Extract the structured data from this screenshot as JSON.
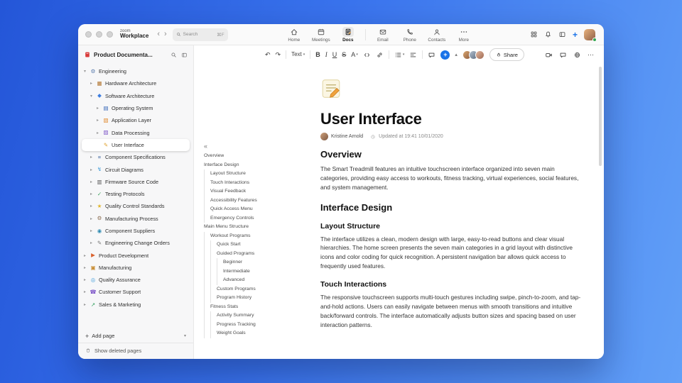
{
  "colors": {
    "accent": "#1a73e8"
  },
  "icons": {
    "undo": "↶",
    "redo": "↷",
    "caret_down": "▾",
    "caret_up": "▴",
    "outline_collapse": "«",
    "plus": "+",
    "more_h": "⋯",
    "tree_expanded": "▾",
    "tree_collapsed": "▸",
    "nav_back": "‹",
    "nav_forward": "›"
  },
  "titlebar": {
    "brand_top": "zoom",
    "brand_bottom": "Workplace",
    "search": {
      "placeholder": "Search",
      "shortcut": "⌘F"
    }
  },
  "topnav": {
    "tabs": [
      {
        "label": "Home"
      },
      {
        "label": "Meetings"
      },
      {
        "label": "Docs",
        "active": true
      },
      {
        "label": "Email"
      },
      {
        "label": "Phone"
      },
      {
        "label": "Contacts"
      },
      {
        "label": "More"
      }
    ]
  },
  "sidebar": {
    "title": "Product Documenta...",
    "items": [
      {
        "label": "Engineering",
        "level": 0,
        "icon": "gear",
        "glyph": "⚙",
        "color": "#5577aa",
        "expanded": true
      },
      {
        "label": "Hardware Architecture",
        "level": 1,
        "icon": "hardware",
        "glyph": "▦",
        "color": "#b0722a"
      },
      {
        "label": "Software Architecture",
        "level": 1,
        "icon": "software",
        "glyph": "◆",
        "color": "#3d7de0",
        "expanded": true
      },
      {
        "label": "Operating System",
        "level": 2,
        "icon": "book",
        "glyph": "▤",
        "color": "#2c5fb3"
      },
      {
        "label": "Application Layer",
        "level": 2,
        "icon": "layers",
        "glyph": "▧",
        "color": "#e08a2e"
      },
      {
        "label": "Data Processing",
        "level": 2,
        "icon": "chart",
        "glyph": "▨",
        "color": "#7a52c7"
      },
      {
        "label": "User Interface",
        "level": 2,
        "icon": "pencil",
        "glyph": "✎",
        "color": "#e0a22e",
        "selected": true
      },
      {
        "label": "Component Specifications",
        "level": 1,
        "icon": "clipboard",
        "glyph": "≡",
        "color": "#4a6fa5"
      },
      {
        "label": "Circuit Diagrams",
        "level": 1,
        "icon": "bolt",
        "glyph": "↯",
        "color": "#3a9ad9"
      },
      {
        "label": "Firmware Source Code",
        "level": 1,
        "icon": "code",
        "glyph": "▥",
        "color": "#5a5a5a"
      },
      {
        "label": "Testing Protocols",
        "level": 1,
        "icon": "check",
        "glyph": "✓",
        "color": "#3aa05a"
      },
      {
        "label": "Quality Control Standards",
        "level": 1,
        "icon": "star",
        "glyph": "★",
        "color": "#e0b52e"
      },
      {
        "label": "Manufacturing Process",
        "level": 1,
        "icon": "factory",
        "glyph": "⚙",
        "color": "#8a6b4f"
      },
      {
        "label": "Component Suppliers",
        "level": 1,
        "icon": "supplier",
        "glyph": "◉",
        "color": "#2e8ab0"
      },
      {
        "label": "Engineering Change Orders",
        "level": 1,
        "icon": "memo",
        "glyph": "✎",
        "color": "#777777"
      },
      {
        "label": "Product Development",
        "level": 0,
        "icon": "rocket",
        "glyph": "▶",
        "color": "#d9622e"
      },
      {
        "label": "Manufacturing",
        "level": 0,
        "icon": "plant",
        "glyph": "▣",
        "color": "#c78a2e"
      },
      {
        "label": "Quality Assurance",
        "level": 0,
        "icon": "target",
        "glyph": "◎",
        "color": "#3a9ad9"
      },
      {
        "label": "Customer Support",
        "level": 0,
        "icon": "phone",
        "glyph": "☎",
        "color": "#7a52c7"
      },
      {
        "label": "Sales & Marketing",
        "level": 0,
        "icon": "trend",
        "glyph": "↗",
        "color": "#2e9e5b"
      }
    ],
    "add_page_label": "Add page",
    "show_deleted_label": "Show deleted pages"
  },
  "outline": {
    "items": [
      {
        "label": "Overview",
        "level": 0
      },
      {
        "label": "Interface Design",
        "level": 0
      },
      {
        "label": "Layout Structure",
        "level": 1
      },
      {
        "label": "Touch Interactions",
        "level": 1
      },
      {
        "label": "Visual Feedback",
        "level": 1
      },
      {
        "label": "Accessibility Features",
        "level": 1
      },
      {
        "label": "Quick Access Menu",
        "level": 1
      },
      {
        "label": "Emergency Controls",
        "level": 1
      },
      {
        "label": "Main Menu Structure",
        "level": 0
      },
      {
        "label": "Workout Programs",
        "level": 1
      },
      {
        "label": "Quick Start",
        "level": 2
      },
      {
        "label": "Guided Programs",
        "level": 2
      },
      {
        "label": "Beginner",
        "level": 3
      },
      {
        "label": "Intermediate",
        "level": 3
      },
      {
        "label": "Advanced",
        "level": 3
      },
      {
        "label": "Custom Programs",
        "level": 2
      },
      {
        "label": "Program History",
        "level": 2
      },
      {
        "label": "Fitness Stats",
        "level": 1
      },
      {
        "label": "Activity Summary",
        "level": 2
      },
      {
        "label": "Progress Tracking",
        "level": 2
      },
      {
        "label": "Weight Goals",
        "level": 2
      }
    ]
  },
  "toolbar": {
    "text_style_label": "Text",
    "bold_label": "B",
    "italic_label": "I",
    "underline_label": "U",
    "strikethrough_label": "S",
    "text_color_label": "A",
    "share_label": "Share"
  },
  "doc": {
    "title": "User Interface",
    "author": "Kristine Arnold",
    "updated": "Updated at 19:41 10/01/2020",
    "sections": [
      {
        "type": "h2",
        "text": "Overview"
      },
      {
        "type": "p",
        "text": "The Smart Treadmill features an intuitive touchscreen interface organized into seven main categories, providing easy access to workouts, fitness tracking, virtual experiences, social features, and system management."
      },
      {
        "type": "h2",
        "text": "Interface Design"
      },
      {
        "type": "h3",
        "text": "Layout Structure"
      },
      {
        "type": "p",
        "text": "The interface utilizes a clean, modern design with large, easy-to-read buttons and clear visual hierarchies. The home screen presents the seven main categories in a grid layout with distinctive icons and color coding for quick recognition. A persistent navigation bar allows quick access to frequently used features."
      },
      {
        "type": "h3",
        "text": "Touch Interactions"
      },
      {
        "type": "p",
        "text": "The responsive touchscreen supports multi-touch gestures including swipe, pinch-to-zoom, and tap-and-hold actions. Users can easily navigate between menus with smooth transitions and intuitive back/forward controls. The interface automatically adjusts button sizes and spacing based on user interaction patterns."
      }
    ]
  }
}
